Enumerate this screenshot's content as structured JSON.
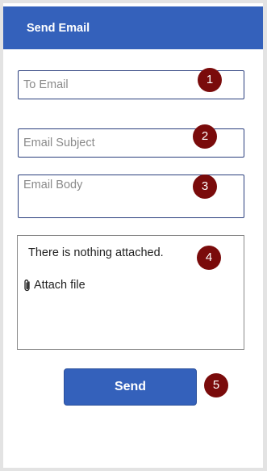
{
  "header": {
    "title": "Send Email"
  },
  "form": {
    "to": {
      "placeholder": "To Email",
      "value": ""
    },
    "subject": {
      "placeholder": "Email Subject",
      "value": ""
    },
    "body": {
      "placeholder": "Email Body",
      "value": ""
    }
  },
  "attachments": {
    "empty_text": "There is nothing attached.",
    "attach_label": "Attach file",
    "attach_icon": "paperclip-icon"
  },
  "actions": {
    "send_label": "Send"
  },
  "markers": [
    "1",
    "2",
    "3",
    "4",
    "5"
  ],
  "colors": {
    "header": "#3461bb",
    "button": "#3461bb",
    "field_border": "#2b3f7e",
    "marker": "#7a0b0b"
  }
}
